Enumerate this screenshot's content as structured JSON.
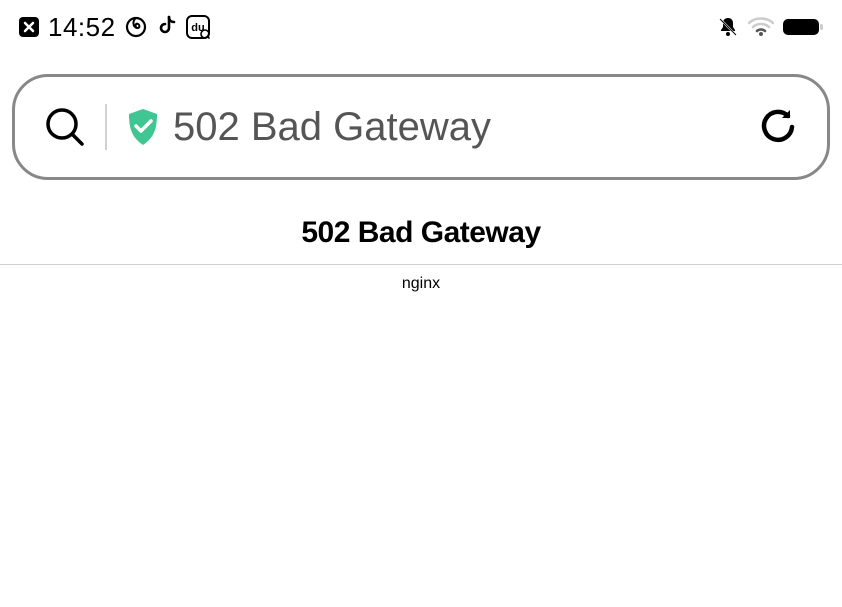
{
  "status_bar": {
    "time": "14:52"
  },
  "address_bar": {
    "page_title": "502 Bad Gateway"
  },
  "page": {
    "error_heading": "502 Bad Gateway",
    "server": "nginx"
  },
  "colors": {
    "shield_green": "#3fc692",
    "border_gray": "#888888",
    "text_gray": "#555555"
  }
}
